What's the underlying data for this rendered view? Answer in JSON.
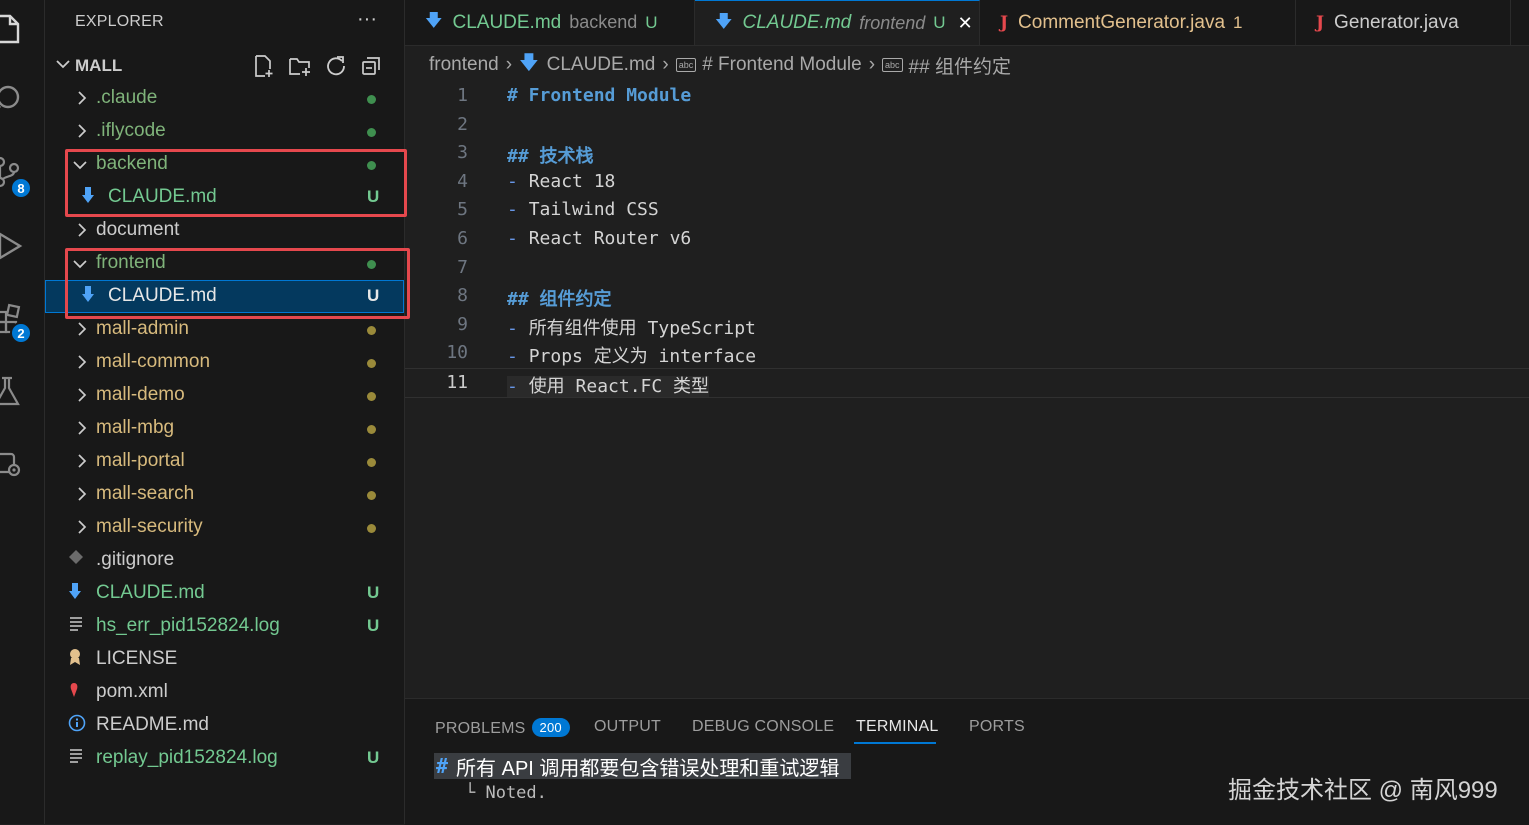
{
  "explorer": {
    "title": "EXPLORER",
    "more": "···",
    "root_label": "MALL",
    "items": [
      {
        "label": ".claude",
        "kind": "folder",
        "open": false,
        "color": "#7fb37a",
        "status_dot": "#3f8f4f"
      },
      {
        "label": ".iflycode",
        "kind": "folder",
        "open": false,
        "color": "#7fb37a",
        "status_dot": "#3f8f4f"
      },
      {
        "label": "backend",
        "kind": "folder",
        "open": true,
        "color": "#7fb37a",
        "status_dot": "#3f8f4f"
      },
      {
        "label": "CLAUDE.md",
        "kind": "md",
        "color": "#73c991",
        "status": "U"
      },
      {
        "label": "document",
        "kind": "folder",
        "open": false,
        "color": "#cccccc"
      },
      {
        "label": "frontend",
        "kind": "folder",
        "open": true,
        "color": "#7fb37a",
        "status_dot": "#3f8f4f"
      },
      {
        "label": "CLAUDE.md",
        "kind": "md",
        "color": "#e7e7e7",
        "status": "U"
      },
      {
        "label": "mall-admin",
        "kind": "folder",
        "open": false,
        "color": "#d7ba7d",
        "status_dot": "#9a8a3a"
      },
      {
        "label": "mall-common",
        "kind": "folder",
        "open": false,
        "color": "#d7ba7d",
        "status_dot": "#9a8a3a"
      },
      {
        "label": "mall-demo",
        "kind": "folder",
        "open": false,
        "color": "#d7ba7d",
        "status_dot": "#9a8a3a"
      },
      {
        "label": "mall-mbg",
        "kind": "folder",
        "open": false,
        "color": "#d7ba7d",
        "status_dot": "#9a8a3a"
      },
      {
        "label": "mall-portal",
        "kind": "folder",
        "open": false,
        "color": "#d7ba7d",
        "status_dot": "#9a8a3a"
      },
      {
        "label": "mall-search",
        "kind": "folder",
        "open": false,
        "color": "#d7ba7d",
        "status_dot": "#9a8a3a"
      },
      {
        "label": "mall-security",
        "kind": "folder",
        "open": false,
        "color": "#d7ba7d",
        "status_dot": "#9a8a3a"
      },
      {
        "label": ".gitignore",
        "kind": "git",
        "color": "#cccccc"
      },
      {
        "label": "CLAUDE.md",
        "kind": "md",
        "color": "#73c991",
        "status": "U"
      },
      {
        "label": "hs_err_pid152824.log",
        "kind": "log",
        "color": "#73c991",
        "status": "U"
      },
      {
        "label": "LICENSE",
        "kind": "license",
        "color": "#cccccc"
      },
      {
        "label": "pom.xml",
        "kind": "xml",
        "color": "#cccccc"
      },
      {
        "label": "README.md",
        "kind": "info",
        "color": "#cccccc"
      },
      {
        "label": "replay_pid152824.log",
        "kind": "log",
        "color": "#73c991",
        "status": "U"
      }
    ]
  },
  "activity": {
    "source_control_badge": "8",
    "extensions_badge": "2"
  },
  "tabs": [
    {
      "label": "CLAUDE.md",
      "sub": "backend",
      "status": "U",
      "icon": "download-arrow-icon",
      "active": false,
      "color": "#73c991"
    },
    {
      "label": "CLAUDE.md",
      "sub": "frontend",
      "status": "U",
      "icon": "download-arrow-icon",
      "active": true,
      "color": "#73c991",
      "close": "✕"
    },
    {
      "label": "CommentGenerator.java",
      "sub": "",
      "status": "1",
      "icon": "java-icon",
      "active": false,
      "color": "#e2c08d"
    },
    {
      "label": "Generator.java",
      "sub": "",
      "status": "",
      "icon": "java-icon",
      "active": false,
      "color": "#cccccc"
    }
  ],
  "breadcrumb": {
    "folder": "frontend",
    "file": "CLAUDE.md",
    "section": "# Frontend Module",
    "subsection": "## 组件约定",
    "box_text": "abc"
  },
  "editor": {
    "lines": [
      {
        "n": "1",
        "text": "# Frontend Module",
        "kind": "h1"
      },
      {
        "n": "2",
        "text": "",
        "kind": "plain"
      },
      {
        "n": "3",
        "text": "## 技术栈",
        "kind": "h2"
      },
      {
        "n": "4",
        "text": "React 18",
        "kind": "bullet"
      },
      {
        "n": "5",
        "text": "Tailwind CSS",
        "kind": "bullet"
      },
      {
        "n": "6",
        "text": "React Router v6",
        "kind": "bullet"
      },
      {
        "n": "7",
        "text": "",
        "kind": "plain"
      },
      {
        "n": "8",
        "text": "## 组件约定",
        "kind": "h2"
      },
      {
        "n": "9",
        "text": "所有组件使用 TypeScript",
        "kind": "bullet"
      },
      {
        "n": "10",
        "text": "Props 定义为 interface",
        "kind": "bullet"
      },
      {
        "n": "11",
        "text": "使用 React.FC 类型",
        "kind": "bullet",
        "current": true
      }
    ]
  },
  "panel": {
    "tabs": [
      {
        "label": "PROBLEMS",
        "badge": "200"
      },
      {
        "label": "OUTPUT"
      },
      {
        "label": "DEBUG CONSOLE"
      },
      {
        "label": "TERMINAL",
        "active": true
      },
      {
        "label": "PORTS"
      }
    ],
    "terminal_hash": "#",
    "terminal_line1": "所有 API 调用都要包含错误处理和重试逻辑",
    "terminal_line2": "└ Noted."
  },
  "watermark": "掘金技术社区 @ 南风999",
  "colors": {
    "accent": "#0078d4",
    "heading": "#569cd6",
    "untracked": "#73c991",
    "modified_folder": "#d7ba7d",
    "highlight_box": "#e5484d"
  }
}
